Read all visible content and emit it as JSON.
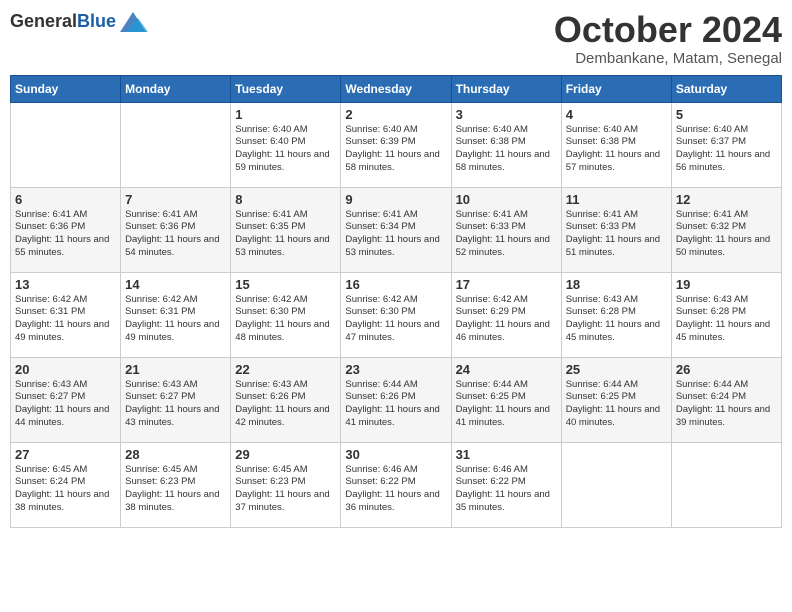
{
  "logo": {
    "general": "General",
    "blue": "Blue"
  },
  "title": "October 2024",
  "location": "Dembankane, Matam, Senegal",
  "days_of_week": [
    "Sunday",
    "Monday",
    "Tuesday",
    "Wednesday",
    "Thursday",
    "Friday",
    "Saturday"
  ],
  "weeks": [
    [
      {
        "day": "",
        "info": ""
      },
      {
        "day": "",
        "info": ""
      },
      {
        "day": "1",
        "info": "Sunrise: 6:40 AM\nSunset: 6:40 PM\nDaylight: 11 hours and 59 minutes."
      },
      {
        "day": "2",
        "info": "Sunrise: 6:40 AM\nSunset: 6:39 PM\nDaylight: 11 hours and 58 minutes."
      },
      {
        "day": "3",
        "info": "Sunrise: 6:40 AM\nSunset: 6:38 PM\nDaylight: 11 hours and 58 minutes."
      },
      {
        "day": "4",
        "info": "Sunrise: 6:40 AM\nSunset: 6:38 PM\nDaylight: 11 hours and 57 minutes."
      },
      {
        "day": "5",
        "info": "Sunrise: 6:40 AM\nSunset: 6:37 PM\nDaylight: 11 hours and 56 minutes."
      }
    ],
    [
      {
        "day": "6",
        "info": "Sunrise: 6:41 AM\nSunset: 6:36 PM\nDaylight: 11 hours and 55 minutes."
      },
      {
        "day": "7",
        "info": "Sunrise: 6:41 AM\nSunset: 6:36 PM\nDaylight: 11 hours and 54 minutes."
      },
      {
        "day": "8",
        "info": "Sunrise: 6:41 AM\nSunset: 6:35 PM\nDaylight: 11 hours and 53 minutes."
      },
      {
        "day": "9",
        "info": "Sunrise: 6:41 AM\nSunset: 6:34 PM\nDaylight: 11 hours and 53 minutes."
      },
      {
        "day": "10",
        "info": "Sunrise: 6:41 AM\nSunset: 6:33 PM\nDaylight: 11 hours and 52 minutes."
      },
      {
        "day": "11",
        "info": "Sunrise: 6:41 AM\nSunset: 6:33 PM\nDaylight: 11 hours and 51 minutes."
      },
      {
        "day": "12",
        "info": "Sunrise: 6:41 AM\nSunset: 6:32 PM\nDaylight: 11 hours and 50 minutes."
      }
    ],
    [
      {
        "day": "13",
        "info": "Sunrise: 6:42 AM\nSunset: 6:31 PM\nDaylight: 11 hours and 49 minutes."
      },
      {
        "day": "14",
        "info": "Sunrise: 6:42 AM\nSunset: 6:31 PM\nDaylight: 11 hours and 49 minutes."
      },
      {
        "day": "15",
        "info": "Sunrise: 6:42 AM\nSunset: 6:30 PM\nDaylight: 11 hours and 48 minutes."
      },
      {
        "day": "16",
        "info": "Sunrise: 6:42 AM\nSunset: 6:30 PM\nDaylight: 11 hours and 47 minutes."
      },
      {
        "day": "17",
        "info": "Sunrise: 6:42 AM\nSunset: 6:29 PM\nDaylight: 11 hours and 46 minutes."
      },
      {
        "day": "18",
        "info": "Sunrise: 6:43 AM\nSunset: 6:28 PM\nDaylight: 11 hours and 45 minutes."
      },
      {
        "day": "19",
        "info": "Sunrise: 6:43 AM\nSunset: 6:28 PM\nDaylight: 11 hours and 45 minutes."
      }
    ],
    [
      {
        "day": "20",
        "info": "Sunrise: 6:43 AM\nSunset: 6:27 PM\nDaylight: 11 hours and 44 minutes."
      },
      {
        "day": "21",
        "info": "Sunrise: 6:43 AM\nSunset: 6:27 PM\nDaylight: 11 hours and 43 minutes."
      },
      {
        "day": "22",
        "info": "Sunrise: 6:43 AM\nSunset: 6:26 PM\nDaylight: 11 hours and 42 minutes."
      },
      {
        "day": "23",
        "info": "Sunrise: 6:44 AM\nSunset: 6:26 PM\nDaylight: 11 hours and 41 minutes."
      },
      {
        "day": "24",
        "info": "Sunrise: 6:44 AM\nSunset: 6:25 PM\nDaylight: 11 hours and 41 minutes."
      },
      {
        "day": "25",
        "info": "Sunrise: 6:44 AM\nSunset: 6:25 PM\nDaylight: 11 hours and 40 minutes."
      },
      {
        "day": "26",
        "info": "Sunrise: 6:44 AM\nSunset: 6:24 PM\nDaylight: 11 hours and 39 minutes."
      }
    ],
    [
      {
        "day": "27",
        "info": "Sunrise: 6:45 AM\nSunset: 6:24 PM\nDaylight: 11 hours and 38 minutes."
      },
      {
        "day": "28",
        "info": "Sunrise: 6:45 AM\nSunset: 6:23 PM\nDaylight: 11 hours and 38 minutes."
      },
      {
        "day": "29",
        "info": "Sunrise: 6:45 AM\nSunset: 6:23 PM\nDaylight: 11 hours and 37 minutes."
      },
      {
        "day": "30",
        "info": "Sunrise: 6:46 AM\nSunset: 6:22 PM\nDaylight: 11 hours and 36 minutes."
      },
      {
        "day": "31",
        "info": "Sunrise: 6:46 AM\nSunset: 6:22 PM\nDaylight: 11 hours and 35 minutes."
      },
      {
        "day": "",
        "info": ""
      },
      {
        "day": "",
        "info": ""
      }
    ]
  ]
}
